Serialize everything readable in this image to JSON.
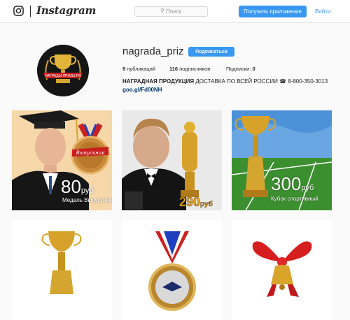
{
  "topbar": {
    "logo_text": "Instagram",
    "search_placeholder": "Поиск",
    "get_app_label": "Получить приложение",
    "login_label": "Войти"
  },
  "profile": {
    "username": "nagrada_priz",
    "subscribe_label": "Подписаться",
    "posts_count": "9",
    "posts_label": "публикаций",
    "followers_count": "116",
    "followers_label": "подписчиков",
    "following_label": "Подписки:",
    "following_count": "0",
    "bio_bold": "НАГРАДНАЯ ПРОДУКЦИЯ",
    "bio_text": "ДОСТАВКА ПО ВСЕЙ РОССИИ ☎ 8-800-350-3013",
    "link": "goo.gl/Fd00NH",
    "avatar_ribbon_text": "НАГРАДЫ ПРИЗЫ.РФ"
  },
  "posts": [
    {
      "price": "80",
      "currency": "руб",
      "caption": "Медаль Выпускник",
      "badge_text": "Выпускник"
    },
    {
      "price": "290",
      "currency": "руб"
    },
    {
      "price": "300",
      "currency": "руб",
      "caption": "Кубок спортивный"
    },
    {},
    {},
    {}
  ],
  "colors": {
    "accent": "#3897f0",
    "background": "#fafafa",
    "link": "#003569"
  }
}
